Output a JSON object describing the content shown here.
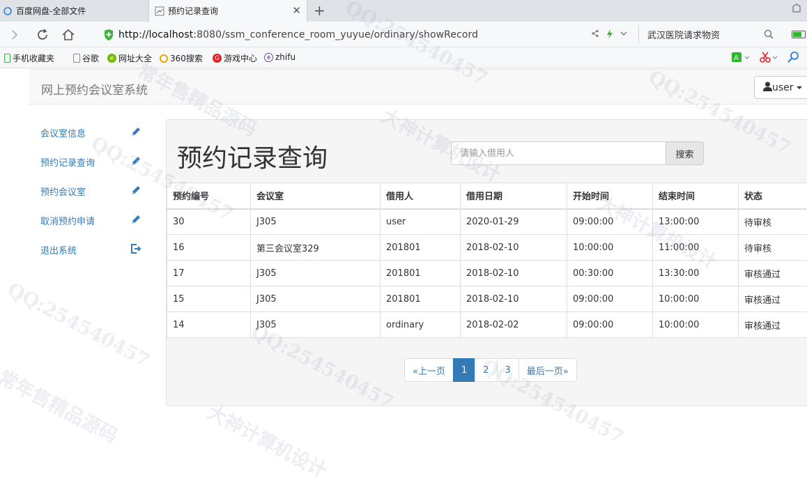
{
  "browser": {
    "tabs": [
      {
        "title": "百度网盘-全部文件",
        "active": false
      },
      {
        "title": "预约记录查询",
        "active": true
      }
    ],
    "url_host": "http://localhost",
    "url_rest": ":8080/ssm_conference_room_yuyue/ordinary/showRecord",
    "search_text": "武汉医院请求物资",
    "bookmarks": [
      "手机收藏夹",
      "谷歌",
      "网址大全",
      "360搜索",
      "游戏中心",
      "zhifu"
    ]
  },
  "app": {
    "brand": "网上预约会议室系统",
    "user_label": "user"
  },
  "sidebar": {
    "items": [
      {
        "label": "会议室信息",
        "icon": "pencil-icon"
      },
      {
        "label": "预约记录查询",
        "icon": "pencil-icon"
      },
      {
        "label": "预约会议室",
        "icon": "pencil-icon"
      },
      {
        "label": "取消预约申请",
        "icon": "pencil-icon"
      },
      {
        "label": "退出系统",
        "icon": "logout-icon"
      }
    ]
  },
  "main": {
    "title": "预约记录查询",
    "search_placeholder": "请输入借用人",
    "search_button": "搜索",
    "table": {
      "headers": [
        "预约编号",
        "会议室",
        "借用人",
        "借用日期",
        "开始时间",
        "结束时间",
        "状态"
      ],
      "rows": [
        [
          "30",
          "J305",
          "user",
          "2020-01-29",
          "09:00:00",
          "13:00:00",
          "待审核"
        ],
        [
          "16",
          "第三会议室329",
          "201801",
          "2018-02-10",
          "10:00:00",
          "11:00:00",
          "待审核"
        ],
        [
          "17",
          "J305",
          "201801",
          "2018-02-10",
          "00:30:00",
          "13:30:00",
          "审核通过"
        ],
        [
          "15",
          "J305",
          "201801",
          "2018-02-10",
          "09:00:00",
          "10:00:00",
          "审核通过"
        ],
        [
          "14",
          "J305",
          "ordinary",
          "2018-02-02",
          "09:00:00",
          "10:00:00",
          "审核通过"
        ]
      ]
    },
    "pagination": {
      "prev": "«上一页",
      "pages": [
        "1",
        "2",
        "3"
      ],
      "active_page": "1",
      "last": "最后一页»"
    }
  },
  "watermark": {
    "lines": [
      "QQ:254540457",
      "大神计算机设计",
      "常年售精品源码"
    ]
  }
}
